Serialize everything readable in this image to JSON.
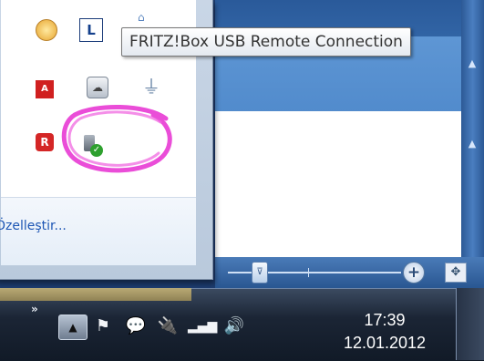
{
  "tooltip": {
    "text": "FRITZ!Box USB Remote Connection"
  },
  "tray_popup": {
    "customize_label": "Özelleştir...",
    "icons": [
      {
        "name": "clock-alarm-icon"
      },
      {
        "name": "l-app-icon"
      },
      {
        "name": "network-cap-icon"
      },
      {
        "name": "adobe-icon"
      },
      {
        "name": "cloud-drive-icon"
      },
      {
        "name": "usb-gray-icon"
      },
      {
        "name": "avira-icon"
      },
      {
        "name": "fritzbox-usb-connected-icon"
      }
    ]
  },
  "taskbar": {
    "overflow_hint": "»",
    "clock_time": "17:39",
    "clock_date": "12.01.2012"
  },
  "zoom": {
    "level_fraction": 0.2
  },
  "colors": {
    "annotation": "#e83ad4",
    "link": "#1d56b4"
  }
}
